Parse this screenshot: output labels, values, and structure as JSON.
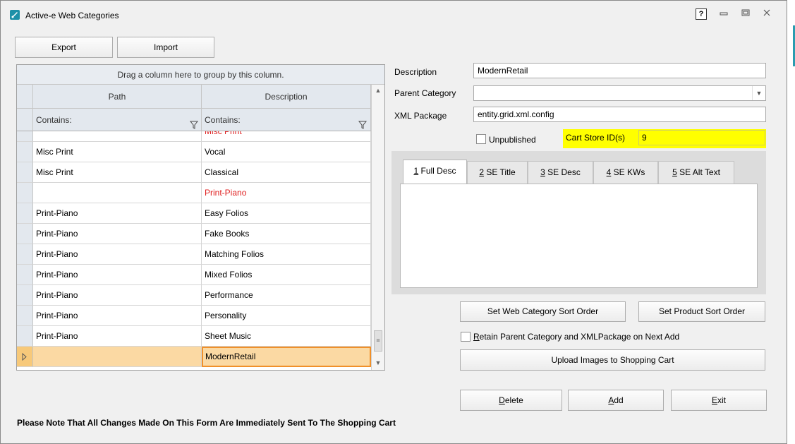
{
  "window": {
    "title": "Active-e Web Categories",
    "help": "?"
  },
  "toolbar": {
    "export": "Export",
    "import": "Import"
  },
  "grid": {
    "group_hint": "Drag a column here to group by this column.",
    "columns": [
      "Path",
      "Description"
    ],
    "filter_label": "Contains:",
    "rows": [
      {
        "path": "",
        "description": "Misc Print",
        "red": true
      },
      {
        "path": "Misc Print",
        "description": "Vocal",
        "red": false
      },
      {
        "path": "Misc Print",
        "description": "Classical",
        "red": false
      },
      {
        "path": "",
        "description": "Print-Piano",
        "red": true
      },
      {
        "path": "Print-Piano",
        "description": "Easy Folios",
        "red": false
      },
      {
        "path": "Print-Piano",
        "description": "Fake Books",
        "red": false
      },
      {
        "path": "Print-Piano",
        "description": "Matching Folios",
        "red": false
      },
      {
        "path": "Print-Piano",
        "description": "Mixed Folios",
        "red": false
      },
      {
        "path": "Print-Piano",
        "description": "Performance",
        "red": false
      },
      {
        "path": "Print-Piano",
        "description": "Personality",
        "red": false
      },
      {
        "path": "Print-Piano",
        "description": "Sheet Music",
        "red": false
      },
      {
        "path": "",
        "description": "ModernRetail",
        "red": false,
        "selected": true
      }
    ]
  },
  "form": {
    "description_label": "Description",
    "description_value": "ModernRetail",
    "parent_label": "Parent Category",
    "parent_value": "",
    "xml_label": "XML Package",
    "xml_value": "entity.grid.xml.config",
    "unpublished_label": "Unpublished",
    "cart_store_label": "Cart Store ID(s)",
    "cart_store_value": "9"
  },
  "tabs": [
    {
      "num": "1",
      "label": " Full Desc"
    },
    {
      "num": "2",
      "label": " SE Title"
    },
    {
      "num": "3",
      "label": " SE Desc"
    },
    {
      "num": "4",
      "label": " SE KWs"
    },
    {
      "num": "5",
      "label": " SE Alt Text"
    }
  ],
  "actions": {
    "web_sort": "Set Web Category Sort Order",
    "product_sort": "Set Product Sort Order",
    "retain_first": "R",
    "retain_rest": "etain Parent Category and XMLPackage on Next Add",
    "upload": "Upload Images to Shopping Cart",
    "delete_first": "D",
    "delete_rest": "elete",
    "add_first": "A",
    "add_rest": "dd",
    "exit_first": "E",
    "exit_rest": "xit"
  },
  "notice": "Please Note That All Changes Made On This Form Are Immediately Sent To The Shopping Cart"
}
